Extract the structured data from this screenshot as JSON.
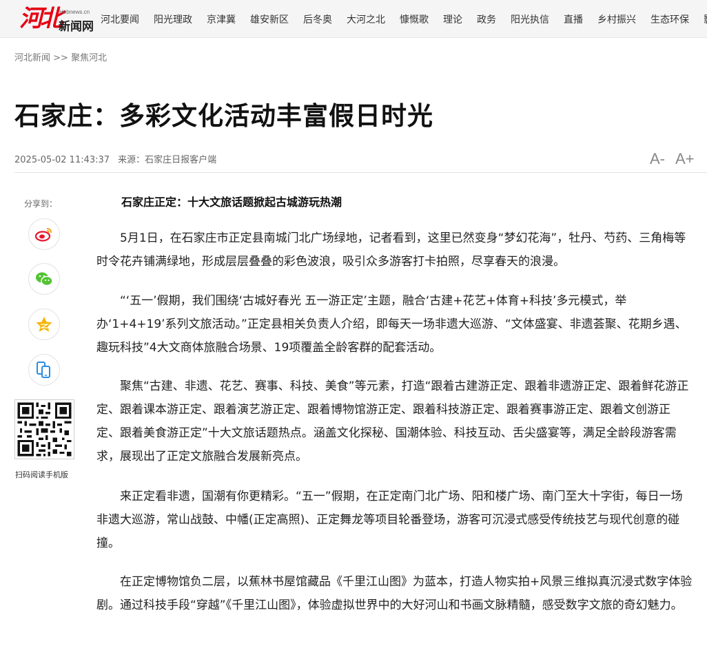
{
  "header": {
    "logo_text": "河北",
    "logo_domain": "Hebnews.cn",
    "logo_name": "新闻网",
    "nav": [
      "河北要闻",
      "阳光理政",
      "京津冀",
      "雄安新区",
      "后冬奥",
      "大河之北",
      "慷慨歌",
      "理论",
      "政务",
      "阳光执信",
      "直播",
      "乡村振兴",
      "生态环保",
      "影"
    ]
  },
  "breadcrumb": {
    "home": "河北新闻",
    "sep": " >> ",
    "section": "聚焦河北"
  },
  "article": {
    "title": "石家庄：多彩文化活动丰富假日时光",
    "datetime": "2025-05-02 11:43:37",
    "source": "来源：石家庄日报客户端",
    "font_decrease": "A-",
    "font_increase": "A+",
    "subhead": "石家庄正定：十大文旅话题掀起古城游玩热潮",
    "paragraphs": [
      "5月1日，在石家庄市正定县南城门北广场绿地，记者看到，这里已然变身“梦幻花海”，牡丹、芍药、三角梅等时令花卉铺满绿地，形成层层叠叠的彩色波浪，吸引众多游客打卡拍照，尽享春天的浪漫。",
      "“‘五一’假期，我们围绕‘古城好春光 五一游正定’主题，融合‘古建+花艺+体育+科技’多元模式，举办‘1+4+19’系列文旅活动。”正定县相关负责人介绍，即每天一场非遗大巡游、“文体盛宴、非遗荟聚、花期乡遇、趣玩科技”4大文商体旅融合场景、19项覆盖全龄客群的配套活动。",
      "聚焦“古建、非遗、花艺、赛事、科技、美食”等元素，打造“跟着古建游正定、跟着非遗游正定、跟着鲜花游正定、跟着课本游正定、跟着演艺游正定、跟着博物馆游正定、跟着科技游正定、跟着赛事游正定、跟着文创游正定、跟着美食游正定”十大文旅话题热点。涵盖文化探秘、国潮体验、科技互动、舌尖盛宴等，满足全龄段游客需求，展现出了正定文旅融合发展新亮点。",
      "来正定看非遗，国潮有你更精彩。“五一”假期，在正定南门北广场、阳和楼广场、南门至大十字街，每日一场非遗大巡游，常山战鼓、中幡(正定高照)、正定舞龙等项目轮番登场，游客可沉浸式感受传统技艺与现代创意的碰撞。",
      "在正定博物馆负二层，以蕉林书屋馆藏品《千里江山图》为蓝本，打造人物实拍+风景三维拟真沉浸式数字体验剧。通过科技手段“穿越”《千里江山图》，体验虚拟世界中的大好河山和书画文脉精髓，感受数字文旅的奇幻魅力。"
    ]
  },
  "share": {
    "label": "分享到：",
    "buttons": [
      "weibo-icon",
      "wechat-icon",
      "qzone-icon",
      "mobile-icon"
    ],
    "qr_caption": "扫码阅读手机版"
  },
  "colors": {
    "brand_red": "#e60012",
    "weibo": "#e6162d",
    "wechat": "#51c332",
    "qzone": "#f5b400",
    "mobile": "#2a8ce5"
  }
}
